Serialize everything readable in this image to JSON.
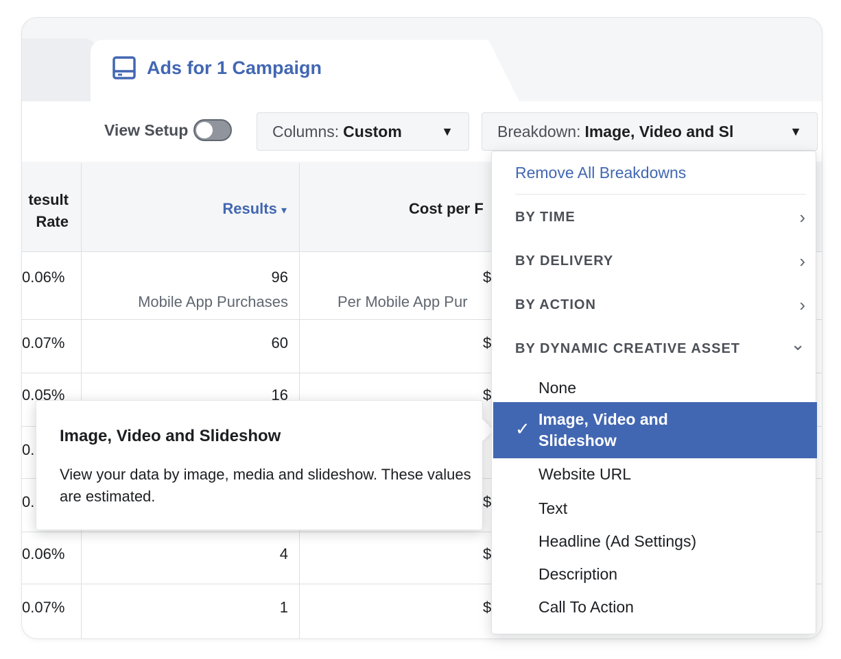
{
  "tab": {
    "title": "Ads for 1 Campaign",
    "icon": "ad-preview-icon"
  },
  "toolbar": {
    "view_setup_label": "View Setup",
    "columns_label": "Columns:",
    "columns_value": "Custom",
    "breakdown_label": "Breakdown:",
    "breakdown_value": "Image, Video and Sl"
  },
  "table": {
    "headers": {
      "result_rate_line1": "Result",
      "result_rate_line1_visible": "tesult",
      "result_rate_line2": "Rate",
      "results": "Results",
      "results_sort": "▾",
      "cost_per": "Cost per F"
    },
    "rows": [
      {
        "rate": "0.06%",
        "results": "96",
        "results_sub": "Mobile App Purchases",
        "cost": "$",
        "cost_sub": "Per Mobile App Pur"
      },
      {
        "rate": "0.07%",
        "results": "60",
        "cost": "$"
      },
      {
        "rate": "0.05%",
        "results": "16",
        "cost": "$"
      },
      {
        "rate": "0.",
        "results": "",
        "cost": ""
      },
      {
        "rate": "0.",
        "results": "",
        "cost": "$"
      },
      {
        "rate": "0.06%",
        "results": "4",
        "cost": "$"
      },
      {
        "rate": "0.07%",
        "results": "1",
        "cost": "$"
      }
    ]
  },
  "tooltip": {
    "title": "Image, Video and Slideshow",
    "body": "View your data by image, media and slideshow. These values are estimated."
  },
  "dropdown": {
    "remove_all": "Remove All Breakdowns",
    "sections": [
      {
        "label": "BY TIME",
        "chevron": "›"
      },
      {
        "label": "BY DELIVERY",
        "chevron": "›"
      },
      {
        "label": "BY ACTION",
        "chevron": "›"
      },
      {
        "label": "BY DYNAMIC CREATIVE ASSET",
        "chevron": "⌄"
      }
    ],
    "items": [
      "None",
      "Image, Video and Slideshow",
      "Website URL",
      "Text",
      "Headline (Ad Settings)",
      "Description",
      "Call To Action"
    ],
    "selected_check": "✓"
  },
  "colors": {
    "accent": "#4267b2",
    "selected_bg": "#4267b2"
  }
}
